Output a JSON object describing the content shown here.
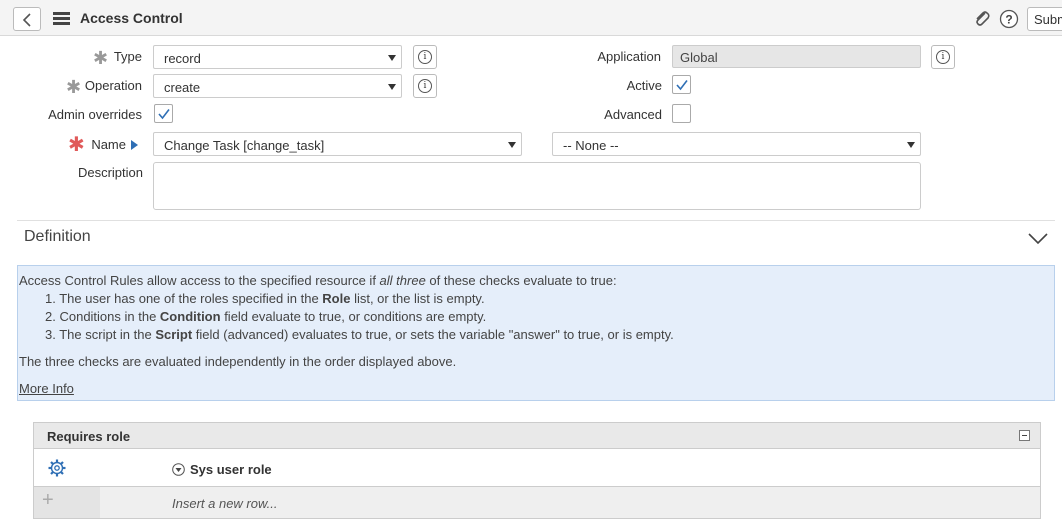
{
  "header": {
    "title": "Access Control",
    "submit_label": "Submit"
  },
  "form": {
    "type": {
      "label": "Type",
      "value": "record"
    },
    "operation": {
      "label": "Operation",
      "value": "create"
    },
    "admin_overrides": {
      "label": "Admin overrides",
      "checked": true
    },
    "name": {
      "label": "Name",
      "table_value": "Change Task [change_task]",
      "field_value": "-- None --"
    },
    "description": {
      "label": "Description",
      "value": ""
    },
    "application": {
      "label": "Application",
      "value": "Global"
    },
    "active": {
      "label": "Active",
      "checked": true
    },
    "advanced": {
      "label": "Advanced",
      "checked": false
    }
  },
  "definition": {
    "title": "Definition",
    "intro_prefix": "Access Control Rules allow access to the specified resource if ",
    "intro_emph": "all three",
    "intro_suffix": " of these checks evaluate to true:",
    "items": [
      {
        "num": "1.",
        "pre": "The user has one of the roles specified in the ",
        "bold": "Role",
        "post": " list, or the list is empty."
      },
      {
        "num": "2.",
        "pre": "Conditions in the ",
        "bold": "Condition",
        "post": " field evaluate to true, or conditions are empty."
      },
      {
        "num": "3.",
        "pre": "The script in the ",
        "bold": "Script",
        "post": " field (advanced) evaluates to true, or sets the variable \"answer\" to true, or is empty."
      }
    ],
    "summary": "The three checks are evaluated independently in the order displayed above.",
    "more_info": "More Info"
  },
  "related_list": {
    "title": "Requires role",
    "column": "Sys user role",
    "insert_placeholder": "Insert a new row..."
  },
  "colors": {
    "required": "#e05a5a",
    "required_gray": "#999999",
    "accent": "#2f6fb5",
    "info_bg": "#e5eefa"
  }
}
